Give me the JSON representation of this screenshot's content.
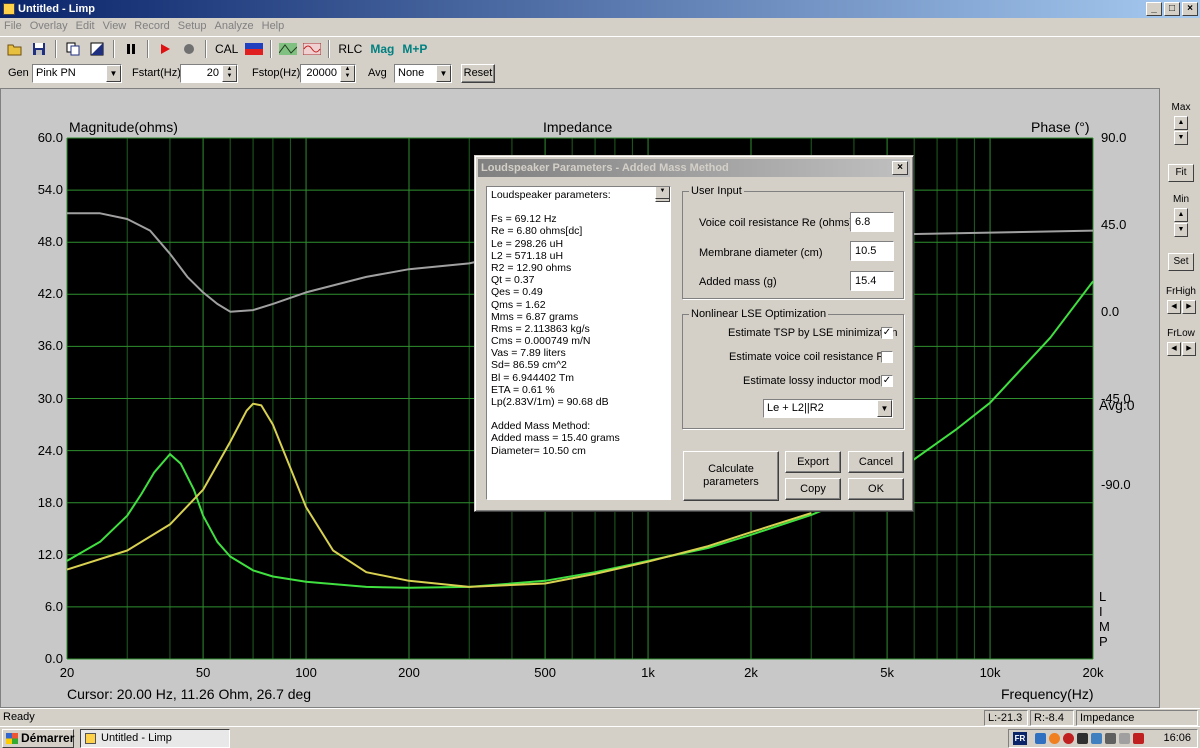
{
  "window": {
    "title": "Untitled - Limp",
    "min": "_",
    "max": "□",
    "close": "×"
  },
  "menu": [
    "File",
    "Overlay",
    "Edit",
    "View",
    "Record",
    "Setup",
    "Analyze",
    "Help"
  ],
  "toolbar": {
    "cal": "CAL",
    "rlc": "RLC",
    "mag": "Mag",
    "mp": "M+P"
  },
  "params": {
    "gen_label": "Gen",
    "gen_value": "Pink PN",
    "fstart_label": "Fstart(Hz)",
    "fstart_value": "20",
    "fstop_label": "Fstop(Hz)",
    "fstop_value": "20000",
    "avg_label": "Avg",
    "avg_value": "None",
    "reset": "Reset"
  },
  "graph": {
    "title": "Impedance",
    "left_axis_label": "Magnitude(ohms)",
    "right_axis_label": "Phase (°)",
    "x_axis_label": "Frequency(Hz)",
    "cursor": "Cursor: 20.00 Hz, 11.26 Ohm, 26.7 deg",
    "avg": "Avg:0",
    "limp": [
      "L",
      "I",
      "M",
      "P"
    ]
  },
  "chart_data": {
    "type": "line",
    "title": "Impedance",
    "xlabel": "Frequency(Hz)",
    "ylabel": "Magnitude(ohms)",
    "y2label": "Phase (°)",
    "xscale": "log",
    "xlim": [
      20,
      20000
    ],
    "ylim": [
      0,
      60
    ],
    "y2lim": [
      -180,
      90
    ],
    "x_ticks": [
      "20",
      "50",
      "100",
      "200",
      "500",
      "1k",
      "2k",
      "5k",
      "10k",
      "20k"
    ],
    "y_ticks": [
      "60.0",
      "54.0",
      "48.0",
      "42.0",
      "36.0",
      "30.0",
      "24.0",
      "18.0",
      "12.0",
      "6.0",
      "0.0"
    ],
    "y2_ticks": [
      "90.0",
      "45.0",
      "0.0",
      "-45.0",
      "-90.0"
    ],
    "grid": true,
    "series": [
      {
        "color": "#40e040",
        "axis": "left",
        "points": [
          [
            20,
            11.3
          ],
          [
            25,
            13.5
          ],
          [
            30,
            16.5
          ],
          [
            33,
            19
          ],
          [
            36,
            21.5
          ],
          [
            40,
            23.6
          ],
          [
            43,
            22.5
          ],
          [
            47,
            19.5
          ],
          [
            50,
            16.5
          ],
          [
            55,
            13.5
          ],
          [
            60,
            11.8
          ],
          [
            70,
            10.2
          ],
          [
            80,
            9.5
          ],
          [
            100,
            8.9
          ],
          [
            150,
            8.3
          ],
          [
            200,
            8.2
          ],
          [
            300,
            8.3
          ],
          [
            500,
            9.0
          ],
          [
            700,
            10.0
          ],
          [
            1000,
            11.3
          ],
          [
            1500,
            12.8
          ],
          [
            2000,
            14.3
          ],
          [
            3000,
            16.6
          ],
          [
            4000,
            18.6
          ],
          [
            5000,
            21.0
          ],
          [
            6000,
            23.0
          ],
          [
            8000,
            26.5
          ],
          [
            10000,
            29.5
          ],
          [
            15000,
            37.0
          ],
          [
            20000,
            43.5
          ]
        ]
      },
      {
        "color": "#d8d050",
        "axis": "left",
        "points": [
          [
            20,
            10.3
          ],
          [
            30,
            12.5
          ],
          [
            40,
            15.5
          ],
          [
            50,
            19.5
          ],
          [
            60,
            25.0
          ],
          [
            67,
            28.6
          ],
          [
            70,
            29.4
          ],
          [
            74,
            29.2
          ],
          [
            80,
            27.0
          ],
          [
            90,
            22.0
          ],
          [
            100,
            17.5
          ],
          [
            120,
            12.5
          ],
          [
            150,
            10.0
          ],
          [
            200,
            9.0
          ],
          [
            300,
            8.3
          ],
          [
            500,
            8.7
          ],
          [
            700,
            9.8
          ],
          [
            1000,
            11.2
          ],
          [
            1500,
            13.0
          ],
          [
            2000,
            14.6
          ],
          [
            3000,
            16.8
          ]
        ]
      },
      {
        "color": "#a0a0a0",
        "axis": "right",
        "points": [
          [
            20,
            51.0
          ],
          [
            25,
            51.0
          ],
          [
            30,
            48.0
          ],
          [
            35,
            42.0
          ],
          [
            40,
            30.0
          ],
          [
            45,
            18.0
          ],
          [
            50,
            10.0
          ],
          [
            55,
            4.0
          ],
          [
            60,
            0.0
          ],
          [
            70,
            0.8
          ],
          [
            80,
            4.0
          ],
          [
            100,
            10.0
          ],
          [
            150,
            18.0
          ],
          [
            200,
            22.0
          ],
          [
            300,
            25.0
          ],
          [
            400,
            30.0
          ],
          [
            5000,
            40.0
          ],
          [
            10000,
            41.0
          ],
          [
            20000,
            42.0
          ]
        ]
      }
    ]
  },
  "right_panel": {
    "max": "Max",
    "fit": "Fit",
    "min": "Min",
    "set": "Set",
    "frhigh": "FrHigh",
    "frlow": "FrLow"
  },
  "status": {
    "ready": "Ready",
    "l": "L:-21.3",
    "r": "R:-8.4",
    "mode": "Impedance Measurement"
  },
  "taskbar": {
    "start": "Démarrer",
    "task": "Untitled - Limp",
    "lang": "FR",
    "clock": "16:06"
  },
  "dialog": {
    "title": "Loudspeaker Parameters - Added Mass Method",
    "report": [
      "Loudspeaker parameters:",
      "",
      "Fs  = 69.12 Hz",
      "Re  = 6.80 ohms[dc]",
      "Le  = 298.26 uH",
      "L2  = 571.18 uH",
      "R2  = 12.90 ohms",
      "Qt  = 0.37",
      "Qes = 0.49",
      "Qms = 1.62",
      "Mms = 6.87 grams",
      "Rms = 2.113863 kg/s",
      "Cms = 0.000749 m/N",
      "Vas = 7.89 liters",
      "Sd= 86.59 cm^2",
      "Bl  = 6.944402 Tm",
      "ETA = 0.61 %",
      "Lp(2.83V/1m) = 90.68 dB",
      "",
      "Added Mass Method:",
      "Added mass = 15.40 grams",
      "Diameter= 10.50 cm"
    ],
    "user_input": {
      "title": "User Input",
      "re_label": "Voice coil resistance Re (ohms)",
      "re_value": "6.8",
      "diam_label": "Membrane diameter (cm)",
      "diam_value": "10.5",
      "mass_label": "Added mass (g)",
      "mass_value": "15.4"
    },
    "nonlinear": {
      "title": "Nonlinear LSE Optimization",
      "opt1": "Estimate TSP by LSE minimization",
      "opt1_checked": "✓",
      "opt2": "Estimate voice coil resistance Re",
      "opt2_checked": "",
      "opt3": "Estimate lossy inductor model",
      "opt3_checked": "✓",
      "model": "Le + L2||R2"
    },
    "buttons": {
      "calc": "Calculate parameters",
      "export": "Export",
      "cancel": "Cancel",
      "copy": "Copy",
      "ok": "OK"
    }
  }
}
